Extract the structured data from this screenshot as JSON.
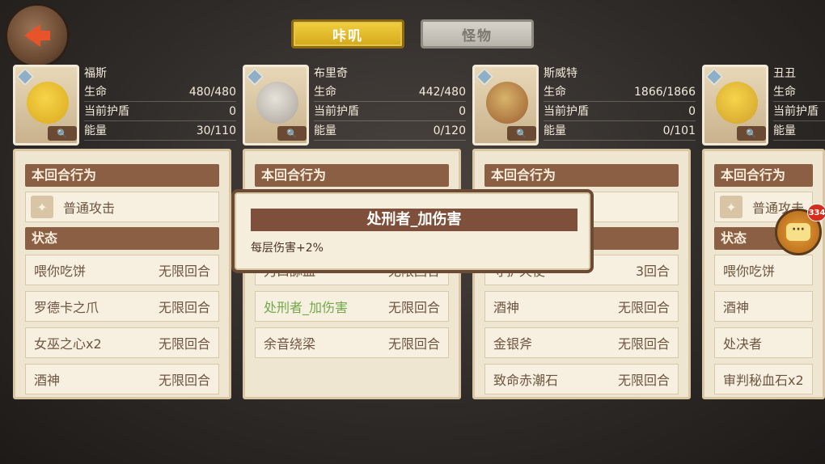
{
  "tabs": {
    "active": "咔叽",
    "inactive": "怪物"
  },
  "heroes": [
    {
      "name": "福斯",
      "hp_label": "生命",
      "hp": "480/480",
      "shield_label": "当前护盾",
      "shield": "0",
      "energy_label": "能量",
      "energy": "30/110"
    },
    {
      "name": "布里奇",
      "hp_label": "生命",
      "hp": "442/480",
      "shield_label": "当前护盾",
      "shield": "0",
      "energy_label": "能量",
      "energy": "0/120"
    },
    {
      "name": "斯威特",
      "hp_label": "生命",
      "hp": "1866/1866",
      "shield_label": "当前护盾",
      "shield": "0",
      "energy_label": "能量",
      "energy": "0/101"
    },
    {
      "name": "丑丑",
      "hp_label": "生命",
      "hp": "",
      "shield_label": "当前护盾",
      "shield": "",
      "energy_label": "能量",
      "energy": ""
    }
  ],
  "panel_labels": {
    "action": "本回合行为",
    "status": "状态"
  },
  "panels": [
    {
      "action": "普通攻击",
      "statuses": [
        {
          "name": "喂你吃饼",
          "dur": "无限回合"
        },
        {
          "name": "罗德卡之爪",
          "dur": "无限回合"
        },
        {
          "name": "女巫之心x2",
          "dur": "无限回合"
        },
        {
          "name": "酒神",
          "dur": "无限回合"
        }
      ]
    },
    {
      "action": "",
      "statuses": [
        {
          "name": "刀口舔血",
          "dur": "无限回合"
        },
        {
          "name": "处刑者_加伤害",
          "dur": "无限回合"
        },
        {
          "name": "余音绕梁",
          "dur": "无限回合"
        }
      ]
    },
    {
      "action": "",
      "statuses": [
        {
          "name": "守护天使",
          "dur": "3回合"
        },
        {
          "name": "酒神",
          "dur": "无限回合"
        },
        {
          "name": "金银斧",
          "dur": "无限回合"
        },
        {
          "name": "致命赤潮石",
          "dur": "无限回合"
        }
      ]
    },
    {
      "action": "普通攻击",
      "statuses": [
        {
          "name": "喂你吃饼",
          "dur": ""
        },
        {
          "name": "酒神",
          "dur": ""
        },
        {
          "name": "处决者",
          "dur": ""
        },
        {
          "name": "审判秘血石x2",
          "dur": ""
        }
      ]
    }
  ],
  "popup": {
    "title": "处刑者_加伤害",
    "desc": "每层伤害+2%"
  },
  "chat": {
    "badge": "334",
    "icon": "···"
  }
}
